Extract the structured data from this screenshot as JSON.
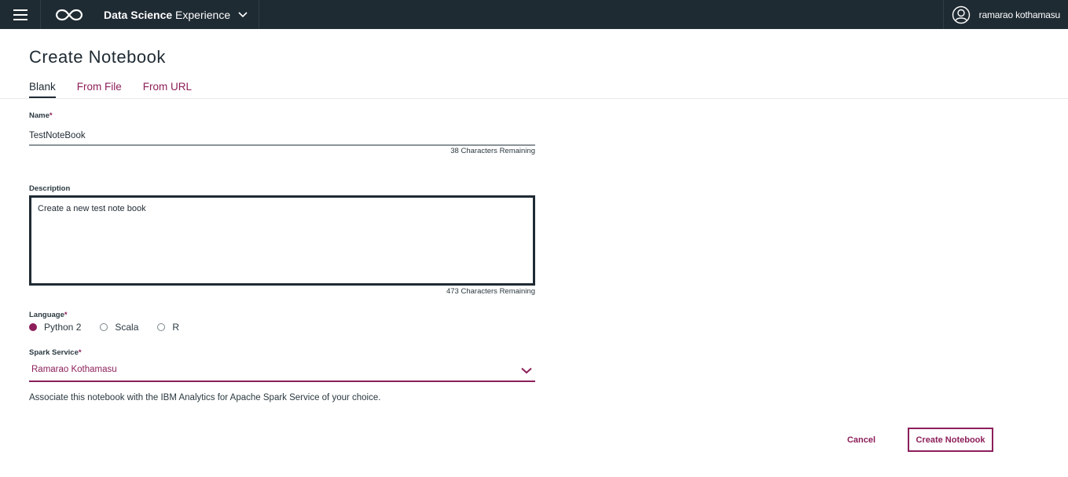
{
  "header": {
    "menu_icon": "hamburger-menu-icon",
    "logo_icon": "infinity-logo-icon",
    "app_name_bold": "Data Science",
    "app_name_rest": " Experience",
    "user_name": "ramarao kothamasu",
    "avatar_icon": "user-avatar-icon",
    "bar_color": "#1f2b33"
  },
  "page": {
    "title": "Create Notebook",
    "tabs": [
      {
        "label": "Blank",
        "active": true
      },
      {
        "label": "From File",
        "active": false
      },
      {
        "label": "From URL",
        "active": false
      }
    ]
  },
  "form": {
    "name_label": "Name",
    "required_mark": "*",
    "name_value": "TestNoteBook",
    "name_remaining": "38 Characters Remaining",
    "description_label": "Description",
    "description_value": "Create a new test note book",
    "description_remaining": "473 Characters Remaining",
    "language_label": "Language",
    "languages": [
      {
        "label": "Python 2",
        "checked": true
      },
      {
        "label": "Scala",
        "checked": false
      },
      {
        "label": "R",
        "checked": false
      }
    ],
    "spark_label": "Spark Service",
    "spark_value": "Ramarao Kothamasu",
    "spark_help": "Associate this notebook with the IBM Analytics for Apache Spark Service of your choice."
  },
  "actions": {
    "cancel_label": "Cancel",
    "create_label": "Create Notebook"
  },
  "colors": {
    "accent": "#8c1f5a",
    "text": "#1f2a33"
  }
}
